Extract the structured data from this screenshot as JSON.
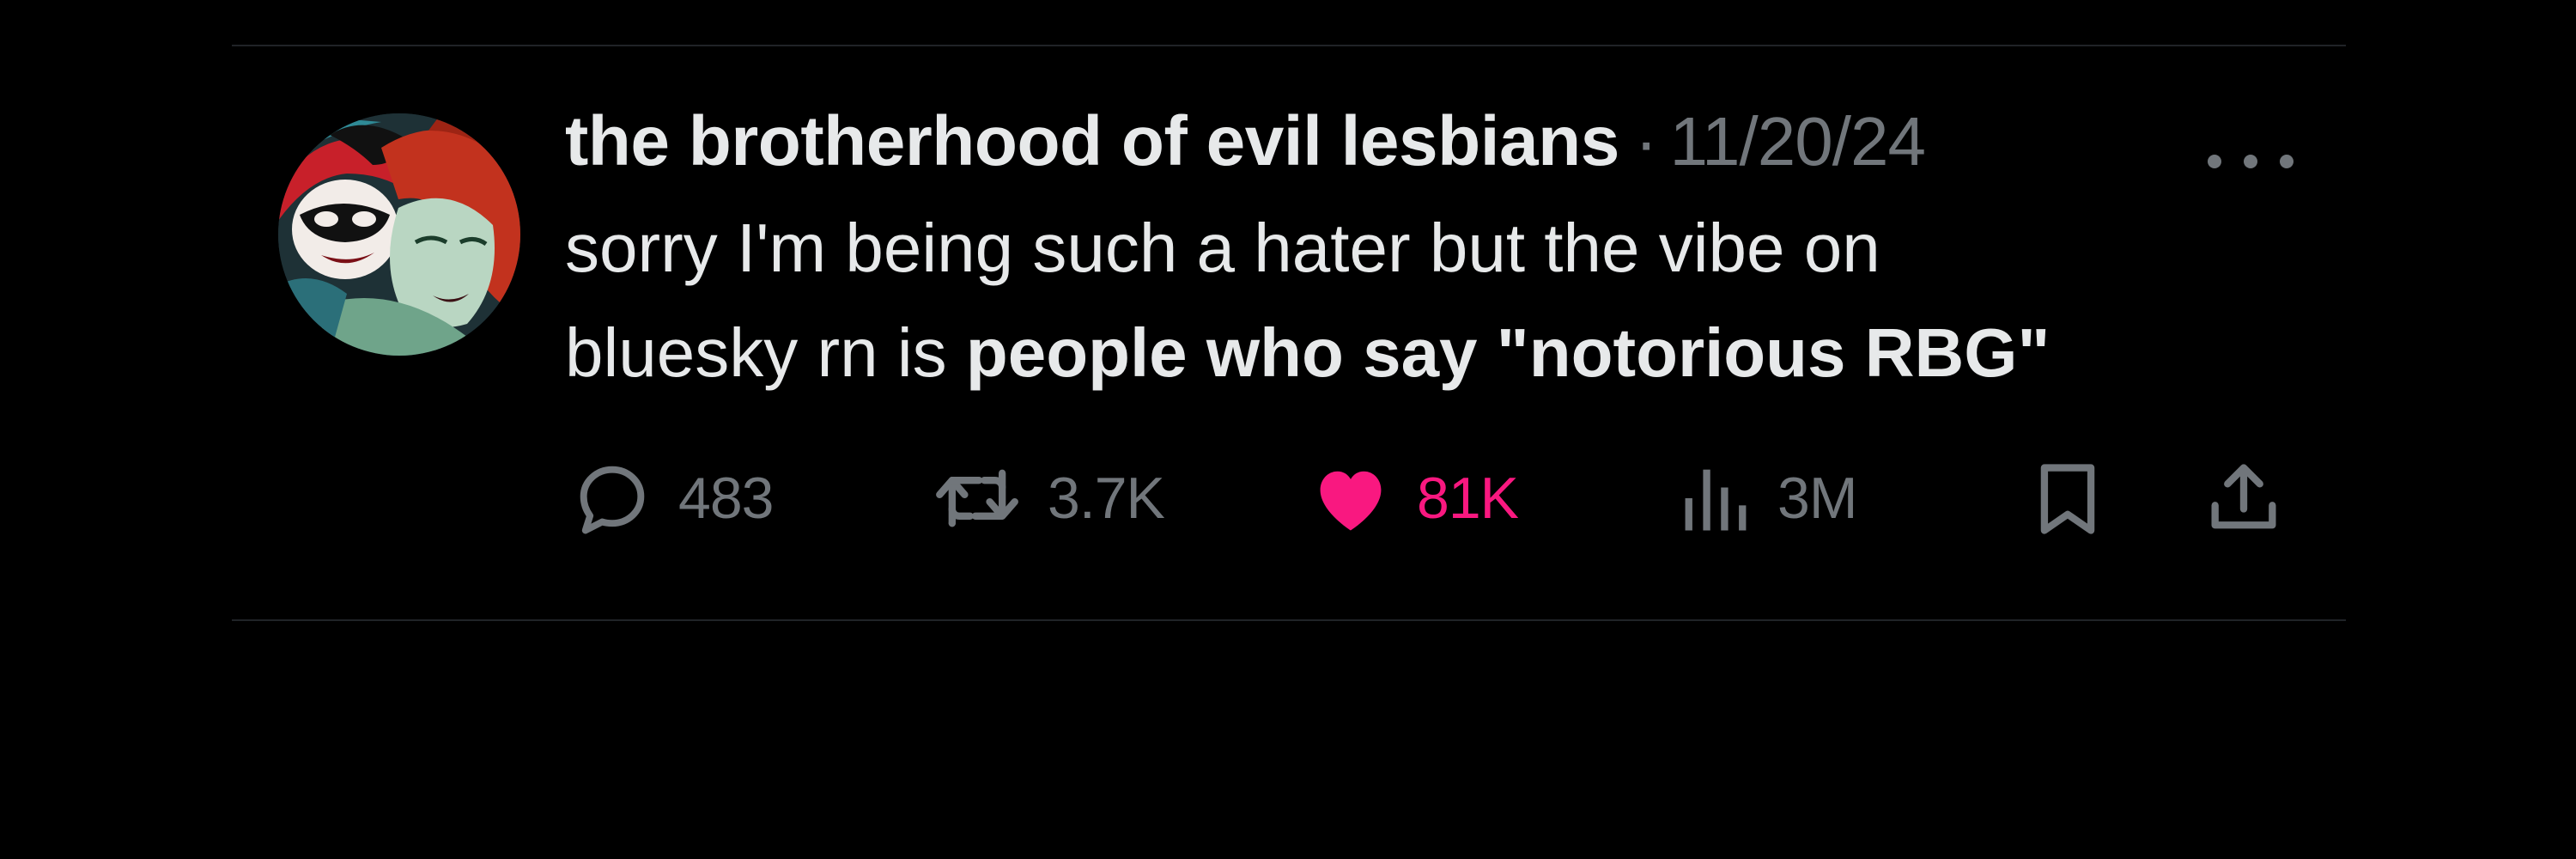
{
  "tweet": {
    "display_name": "the brotherhood of evil lesbians",
    "separator": "·",
    "date": "11/20/24",
    "text_line1": "sorry I'm being such a hater but the vibe on",
    "text_line2_plain": "bluesky rn is ",
    "text_line2_bold": "people who say \"notorious RBG\""
  },
  "actions": {
    "replies": "483",
    "reposts": "3.7K",
    "likes": "81K",
    "views": "3M"
  },
  "icons": {
    "reply": "reply-icon",
    "repost": "repost-icon",
    "like": "heart-icon",
    "views": "views-chart-icon",
    "bookmark": "bookmark-icon",
    "share": "share-icon",
    "more": "more-dots-icon"
  },
  "colors": {
    "background": "#000000",
    "text_primary": "#e7e9ea",
    "text_secondary": "#71767b",
    "like_active": "#f91880",
    "divider": "#202327"
  }
}
